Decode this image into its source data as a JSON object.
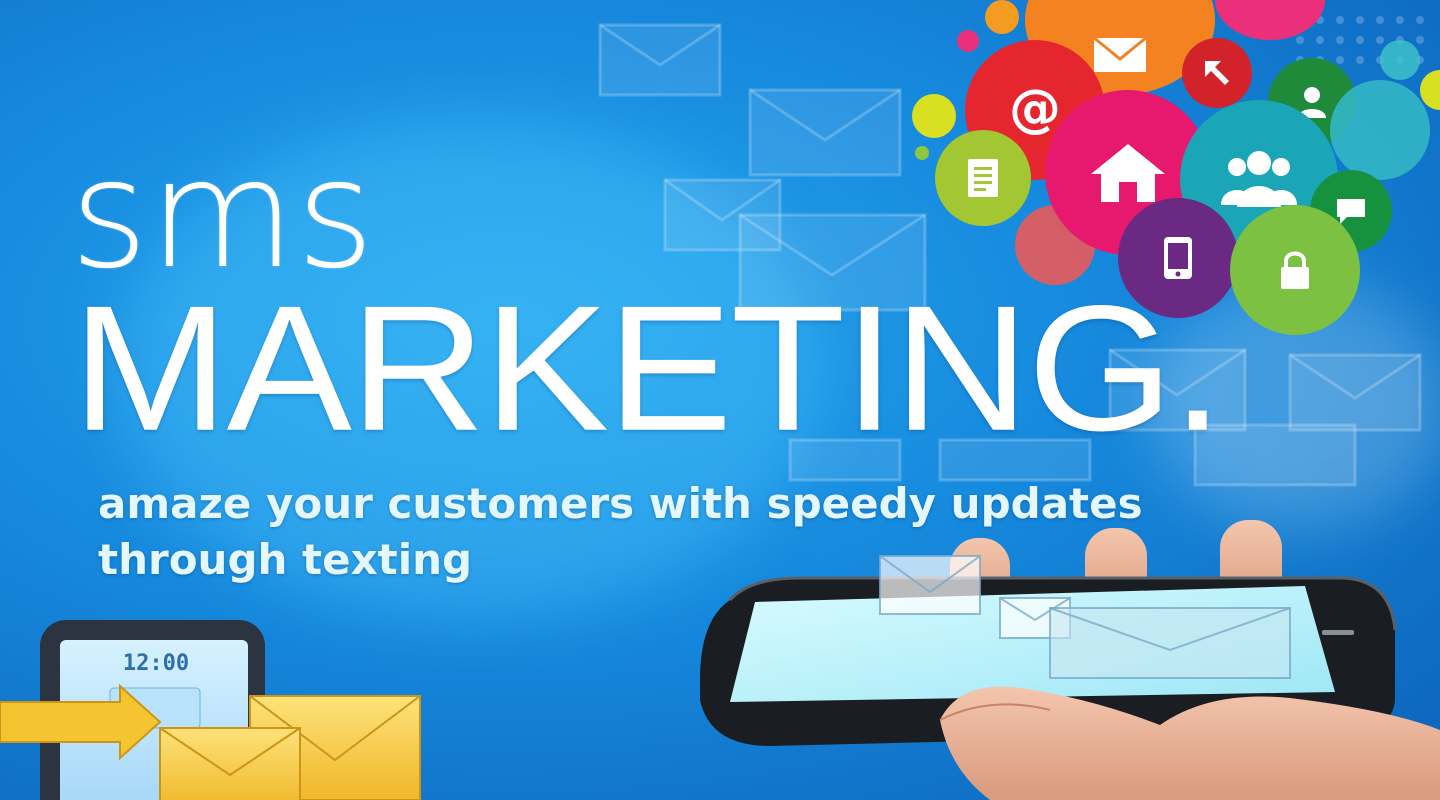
{
  "headline": {
    "small": "sms",
    "large": "MARKETING."
  },
  "tagline": {
    "line1": "amaze your customers with speedy updates",
    "line2": "through  texting"
  },
  "phone_small": {
    "clock": "12:00"
  },
  "colors": {
    "background": "#1689dd",
    "text": "#ffffff",
    "tagline": "#e4f7ff",
    "envelope_yellow": "#f4c531"
  },
  "icons": [
    "mail-icon",
    "at-sign-icon",
    "arrow-icon",
    "user-icon",
    "document-icon",
    "home-icon",
    "group-icon",
    "chat-bubble-icon",
    "mobile-phone-icon",
    "lock-icon"
  ]
}
